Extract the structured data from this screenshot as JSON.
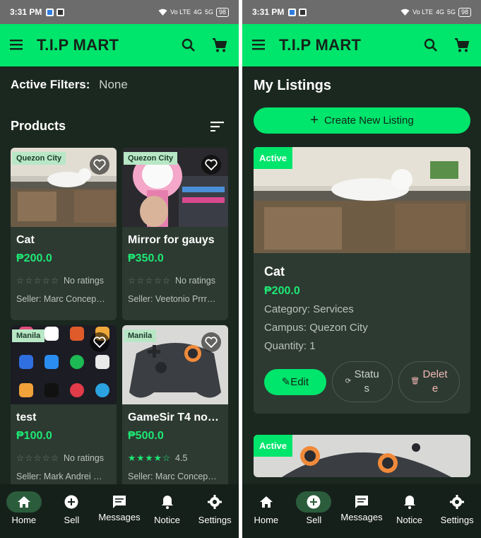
{
  "status_bar": {
    "time": "3:31 PM",
    "battery": "98",
    "net1": "4G",
    "net2": "5G",
    "volte": "Vo LTE"
  },
  "app": {
    "title": "T.I.P MART"
  },
  "colors": {
    "accent": "#00e56b",
    "background": "#1b2820",
    "card": "#2d3a32",
    "price": "#1ee874"
  },
  "browse": {
    "filters_label": "Active Filters:",
    "filters_value": "None",
    "section_title": "Products",
    "products": [
      {
        "location": "Quezon City",
        "name": "Cat",
        "price": "₱200.0",
        "stars": "☆☆☆☆☆",
        "rating_text": "No ratings",
        "seller": "Seller: Marc Concep…"
      },
      {
        "location": "Quezon City",
        "name": "Mirror for gauys",
        "price": "₱350.0",
        "stars": "☆☆☆☆☆",
        "rating_text": "No ratings",
        "seller": "Seller: Veetonio Prrr…"
      },
      {
        "location": "Manila",
        "name": "test",
        "price": "₱100.0",
        "stars": "☆☆☆☆☆",
        "rating_text": "No ratings",
        "seller": "Seller: Mark Andrei …"
      },
      {
        "location": "Manila",
        "name": "GameSir T4 no…",
        "price": "₱500.0",
        "stars": "★★★★☆",
        "rating_text": "4.5",
        "seller": "Seller: Marc Concep…"
      }
    ]
  },
  "listings": {
    "title": "My Listings",
    "create_label": "Create New Listing",
    "items": [
      {
        "status": "Active",
        "name": "Cat",
        "price": "₱200.0",
        "category": "Category: Services",
        "campus": "Campus: Quezon City",
        "quantity": "Quantity: 1",
        "edit_label": "Edit",
        "status_label": "Status",
        "delete_label": "Delete"
      },
      {
        "status": "Active"
      }
    ]
  },
  "nav": {
    "items": [
      {
        "label": "Home",
        "icon": "home-icon"
      },
      {
        "label": "Sell",
        "icon": "add-circle-icon"
      },
      {
        "label": "Messages",
        "icon": "message-icon"
      },
      {
        "label": "Notice",
        "icon": "bell-icon"
      },
      {
        "label": "Settings",
        "icon": "gear-icon"
      }
    ]
  }
}
